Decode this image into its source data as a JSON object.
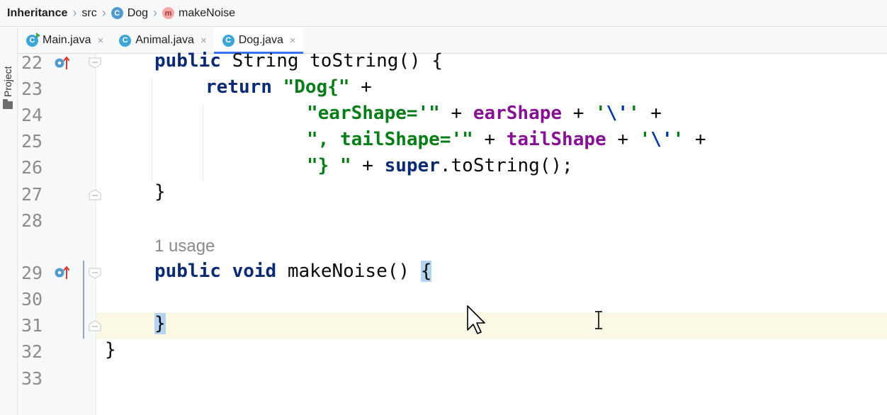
{
  "breadcrumb": {
    "project": "Inheritance",
    "folder": "src",
    "class": "Dog",
    "method": "makeNoise",
    "class_icon_letter": "C",
    "method_icon_letter": "m"
  },
  "toolwindow": {
    "project_label": "Project"
  },
  "tabs": [
    {
      "label": "Main.java",
      "icon": "C",
      "active": false
    },
    {
      "label": "Animal.java",
      "icon": "C",
      "active": false
    },
    {
      "label": "Dog.java",
      "icon": "C",
      "active": true
    }
  ],
  "tab_close_glyph": "×",
  "editor": {
    "line_numbers": [
      "22",
      "23",
      "24",
      "25",
      "26",
      "27",
      "28",
      "29",
      "30",
      "31",
      "32",
      "33"
    ],
    "usage_hint": "1 usage",
    "current_line": "31",
    "code": {
      "l22": {
        "kw1": "public",
        "type": " String ",
        "name": "toString() {"
      },
      "l23": {
        "kw": "return",
        "str": "\"Dog{\"",
        "op": " +"
      },
      "l24": {
        "str": "\"earShape='\"",
        "op1": " + ",
        "fld": "earShape",
        "op2": " + ",
        "chr_open": "'",
        "esc": "\\'",
        "chr_close": "'",
        "op3": " +"
      },
      "l25": {
        "str": "\", tailShape='\"",
        "op1": " + ",
        "fld": "tailShape",
        "op2": " + ",
        "chr_open": "'",
        "esc": "\\'",
        "chr_close": "'",
        "op3": " +"
      },
      "l26": {
        "str": "\"} \"",
        "op1": " + ",
        "kw": "super",
        "rest": ".toString();"
      },
      "l27": {
        "text": "}"
      },
      "l29": {
        "kw1": "public",
        "sp1": " ",
        "kw2": "void",
        "name": " makeNoise() ",
        "brace": "{"
      },
      "l31": {
        "brace": "}"
      },
      "l32": {
        "text": "}"
      }
    }
  },
  "colors": {
    "keyword": "#0033b3",
    "string": "#067d17",
    "field": "#871094",
    "tab_active_underline": "#3574f0",
    "current_line_bg": "#fcf8e6",
    "brace_highlight": "#b5d4f2"
  }
}
